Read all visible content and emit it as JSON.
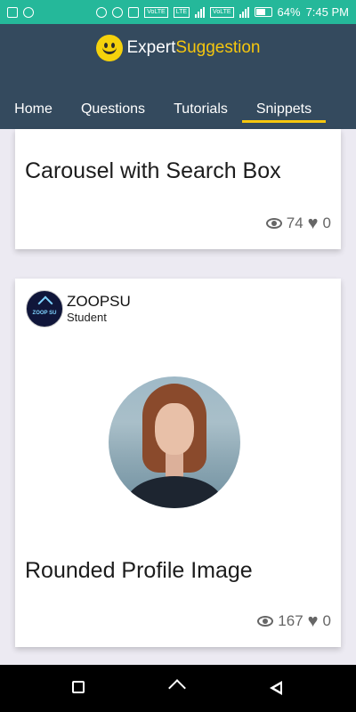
{
  "status_bar": {
    "battery": "64%",
    "time": "7:45 PM",
    "network_labels": [
      "VoLTE",
      "LTE",
      "VoLTE"
    ],
    "icons": [
      "image-icon",
      "settings-icon",
      "headphones-icon",
      "hotspot-icon",
      "vibrate-icon",
      "signal-icon",
      "signal-icon",
      "battery-icon"
    ]
  },
  "header": {
    "brand_part1": "Expert",
    "brand_part2": "Suggestion",
    "tabs": [
      {
        "label": "Home"
      },
      {
        "label": "Questions"
      },
      {
        "label": "Tutorials"
      },
      {
        "label": "Snippets",
        "active": true
      }
    ],
    "colors": {
      "header_bg": "#344a5e",
      "accent": "#f5c60e",
      "status_bg": "#25b89a"
    }
  },
  "posts": [
    {
      "title": "Carousel with Search Box",
      "views": "74",
      "likes": "0"
    },
    {
      "author": {
        "name": "ZOOPSU",
        "role": "Student",
        "logo_text": "ZOOP SU"
      },
      "title": "Rounded Profile Image",
      "views": "167",
      "likes": "0"
    }
  ]
}
